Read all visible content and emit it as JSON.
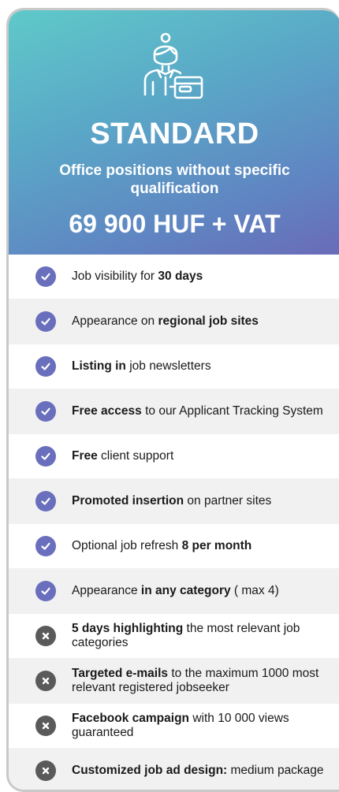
{
  "header": {
    "title": "STANDARD",
    "subtitle": "Office positions without specific qualification",
    "price": "69 900 HUF + VAT",
    "icon": "office-worker-with-box-icon",
    "gradient_colors": [
      "#5fc9c9",
      "#5aa7c7",
      "#5f86c2",
      "#6a6bb8"
    ]
  },
  "colors": {
    "included_badge": "#6a6fbd",
    "excluded_badge": "#5a5a5a",
    "alt_row_bg": "#f1f1f1"
  },
  "features": [
    {
      "included": true,
      "parts": [
        {
          "t": "Job visibility for ",
          "b": false
        },
        {
          "t": "30 days",
          "b": true
        }
      ]
    },
    {
      "included": true,
      "parts": [
        {
          "t": "Appearance on ",
          "b": false
        },
        {
          "t": "regional job sites",
          "b": true
        }
      ]
    },
    {
      "included": true,
      "parts": [
        {
          "t": "Listing in",
          "b": true
        },
        {
          "t": " job newsletters",
          "b": false
        }
      ]
    },
    {
      "included": true,
      "parts": [
        {
          "t": "Free access",
          "b": true
        },
        {
          "t": " to our Applicant Tracking System",
          "b": false
        }
      ]
    },
    {
      "included": true,
      "parts": [
        {
          "t": "Free",
          "b": true
        },
        {
          "t": " client support",
          "b": false
        }
      ]
    },
    {
      "included": true,
      "parts": [
        {
          "t": "Promoted insertion",
          "b": true
        },
        {
          "t": " on partner sites",
          "b": false
        }
      ]
    },
    {
      "included": true,
      "parts": [
        {
          "t": "Optional job refresh ",
          "b": false
        },
        {
          "t": "8 per month",
          "b": true
        }
      ]
    },
    {
      "included": true,
      "parts": [
        {
          "t": "Appearance ",
          "b": false
        },
        {
          "t": "in any category",
          "b": true
        },
        {
          "t": " ( max 4)",
          "b": false
        }
      ]
    },
    {
      "included": false,
      "parts": [
        {
          "t": "5 days highlighting",
          "b": true
        },
        {
          "t": " the most relevant job categories",
          "b": false
        }
      ]
    },
    {
      "included": false,
      "parts": [
        {
          "t": "Targeted e-mails",
          "b": true
        },
        {
          "t": " to the maximum 1000 most relevant registered jobseeker",
          "b": false
        }
      ]
    },
    {
      "included": false,
      "parts": [
        {
          "t": "Facebook campaign",
          "b": true
        },
        {
          "t": " with 10 000 views guaranteed",
          "b": false
        }
      ]
    },
    {
      "included": false,
      "parts": [
        {
          "t": "Customized job ad design:",
          "b": true
        },
        {
          "t": " medium package",
          "b": false
        }
      ]
    }
  ]
}
